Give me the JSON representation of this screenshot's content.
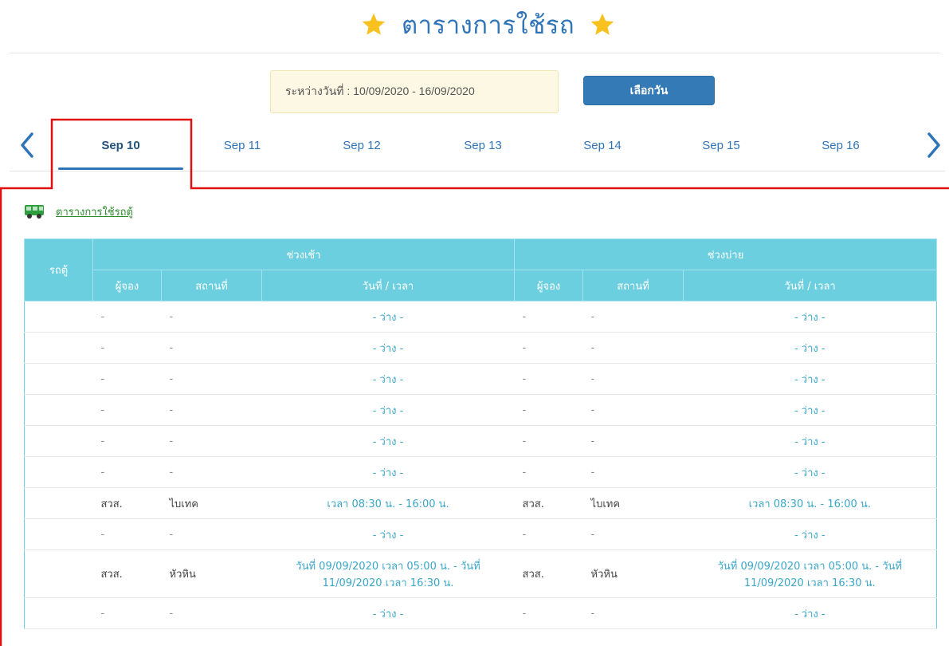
{
  "header": {
    "title": "ตารางการใช้รถ"
  },
  "date_range": {
    "text": "ระหว่างวันที่ : 10/09/2020 - 16/09/2020"
  },
  "pick_button": {
    "label": "เลือกวัน"
  },
  "tabs": [
    {
      "label": "Sep 10",
      "active": true
    },
    {
      "label": "Sep 11"
    },
    {
      "label": "Sep 12"
    },
    {
      "label": "Sep 13"
    },
    {
      "label": "Sep 14"
    },
    {
      "label": "Sep 15"
    },
    {
      "label": "Sep 16"
    }
  ],
  "section": {
    "link": "ตารางการใช้รถตู้"
  },
  "table": {
    "col_vehicle": "รถตู้",
    "morning": "ช่วงเช้า",
    "afternoon": "ช่วงบ่าย",
    "col_booker": "ผู้จอง",
    "col_place": "สถานที่",
    "col_datetime": "วันที่ / เวลา",
    "rows": [
      {
        "vehicle": "",
        "m_booker": "-",
        "m_place": "-",
        "m_time": "- ว่าง -",
        "a_booker": "-",
        "a_place": "-",
        "a_time": "- ว่าง -"
      },
      {
        "vehicle": "",
        "m_booker": "-",
        "m_place": "-",
        "m_time": "- ว่าง -",
        "a_booker": "-",
        "a_place": "-",
        "a_time": "- ว่าง -"
      },
      {
        "vehicle": "",
        "m_booker": "-",
        "m_place": "-",
        "m_time": "- ว่าง -",
        "a_booker": "-",
        "a_place": "-",
        "a_time": "- ว่าง -"
      },
      {
        "vehicle": "",
        "m_booker": "-",
        "m_place": "-",
        "m_time": "- ว่าง -",
        "a_booker": "-",
        "a_place": "-",
        "a_time": "- ว่าง -"
      },
      {
        "vehicle": "",
        "m_booker": "-",
        "m_place": "-",
        "m_time": "- ว่าง -",
        "a_booker": "-",
        "a_place": "-",
        "a_time": "- ว่าง -"
      },
      {
        "vehicle": "",
        "m_booker": "-",
        "m_place": "-",
        "m_time": "- ว่าง -",
        "a_booker": "-",
        "a_place": "-",
        "a_time": "- ว่าง -"
      },
      {
        "vehicle": "",
        "m_booker": "สวส.",
        "m_place": "ไบเทค",
        "m_time": "เวลา 08:30 น. - 16:00 น.",
        "a_booker": "สวส.",
        "a_place": "ไบเทค",
        "a_time": "เวลา 08:30 น. - 16:00 น."
      },
      {
        "vehicle": "",
        "m_booker": "-",
        "m_place": "-",
        "m_time": "- ว่าง -",
        "a_booker": "-",
        "a_place": "-",
        "a_time": "- ว่าง -"
      },
      {
        "vehicle": "",
        "m_booker": "สวส.",
        "m_place": "หัวหิน",
        "m_time": "วันที่ 09/09/2020 เวลา 05:00 น. - วันที่ 11/09/2020 เวลา 16:30 น.",
        "a_booker": "สวส.",
        "a_place": "หัวหิน",
        "a_time": "วันที่ 09/09/2020 เวลา 05:00 น. - วันที่ 11/09/2020 เวลา 16:30 น."
      },
      {
        "vehicle": "",
        "m_booker": "-",
        "m_place": "-",
        "m_time": "- ว่าง -",
        "a_booker": "-",
        "a_place": "-",
        "a_time": "- ว่าง -"
      }
    ]
  },
  "colors": {
    "accent": "#2f74b9",
    "table_header": "#6ccfe0",
    "highlight_frame": "#e01010",
    "date_box": "#fcf8e3"
  }
}
